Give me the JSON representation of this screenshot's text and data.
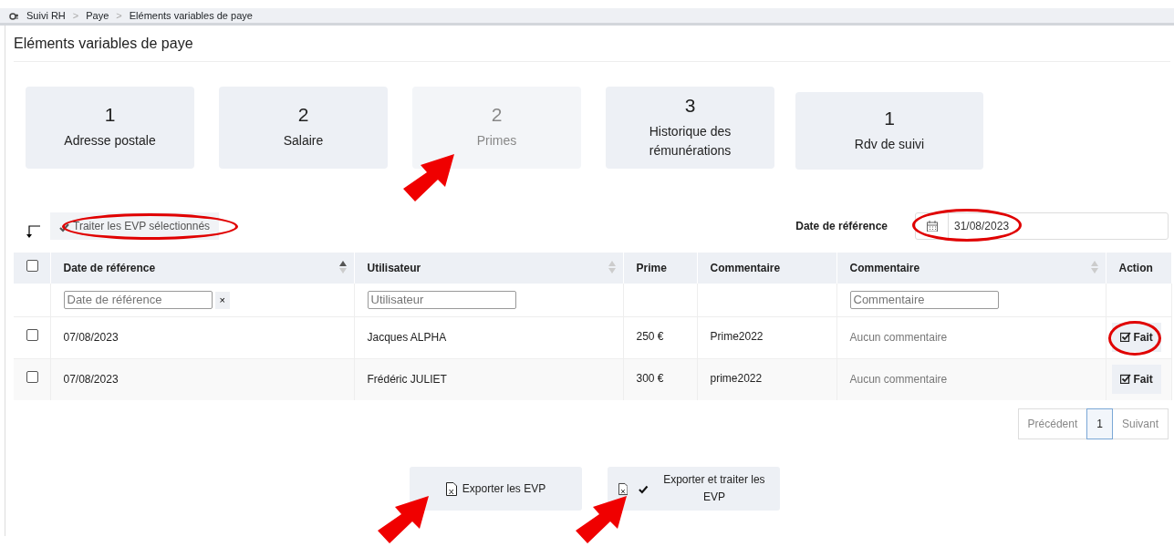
{
  "breadcrumb": {
    "separator": ">",
    "items": [
      {
        "label": "Suivi RH"
      },
      {
        "label": "Paye"
      },
      {
        "label": "Eléments variables de paye"
      }
    ]
  },
  "page_title": "Eléments variables de paye",
  "tiles": [
    {
      "count": "1",
      "label": "Adresse postale",
      "selected": false,
      "arrow": false
    },
    {
      "count": "2",
      "label": "Salaire",
      "selected": false,
      "arrow": false
    },
    {
      "count": "2",
      "label": "Primes",
      "selected": true,
      "arrow": true
    },
    {
      "count": "3",
      "label": "Historique des rémunérations",
      "selected": false,
      "arrow": false
    },
    {
      "count": "1",
      "label": "Rdv de suivi",
      "selected": false,
      "arrow": false
    }
  ],
  "toolbar": {
    "bulk_button": {
      "label": "Traiter les EVP sélectionnés",
      "circled": true
    },
    "date_label": "Date de référence",
    "date_value": "31/08/2023",
    "date_circled": true
  },
  "table": {
    "select_all_checked": false,
    "columns": [
      {
        "label": "Date de référence",
        "sortable": true,
        "sorted_ascending": true,
        "filter_placeholder": "Date de référence",
        "filter_clear": "×"
      },
      {
        "label": "Utilisateur",
        "sortable": true,
        "sorted_ascending": false,
        "filter_placeholder": "Utilisateur"
      },
      {
        "label": "Prime"
      },
      {
        "label": "Commentaire"
      },
      {
        "label": "Commentaire",
        "sortable": true,
        "sorted_ascending": false,
        "filter_placeholder": "Commentaire"
      },
      {
        "label": "Action"
      }
    ],
    "rows": [
      {
        "checked": false,
        "date": "07/08/2023",
        "user": "Jacques ALPHA",
        "prime": "250 €",
        "comment": "Prime2022",
        "note": "Aucun commentaire",
        "action": "Fait",
        "action_circled": true
      },
      {
        "checked": false,
        "date": "07/08/2023",
        "user": "Frédéric JULIET",
        "prime": "300 €",
        "comment": "prime2022",
        "note": "Aucun commentaire",
        "action": "Fait",
        "action_circled": false
      }
    ]
  },
  "pagination": [
    {
      "label": "Précédent",
      "selected": false
    },
    {
      "label": "1",
      "selected": true
    },
    {
      "label": "Suivant",
      "selected": false
    }
  ],
  "exports": [
    {
      "label": "Exporter les EVP",
      "check_icon": false,
      "arrow": true
    },
    {
      "label": "Exporter et traiter les EVP",
      "check_icon": true,
      "arrow": true
    }
  ]
}
